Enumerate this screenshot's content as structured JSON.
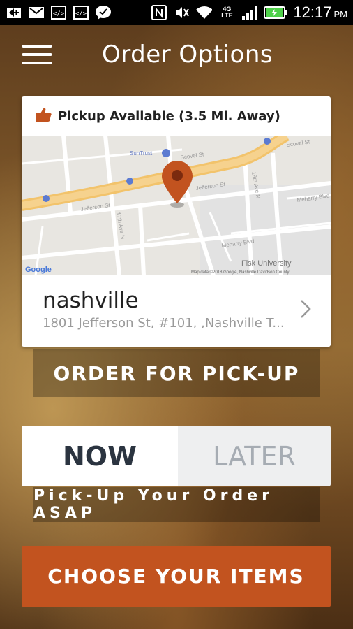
{
  "status_bar": {
    "time": "12:17",
    "ampm": "PM",
    "network": "4G LTE",
    "icons": [
      "add-icon",
      "gmail-icon",
      "code-icon",
      "code-icon",
      "chat-icon",
      "nfc-icon",
      "mute-icon",
      "wifi-icon",
      "signal-icon",
      "battery-icon"
    ]
  },
  "header": {
    "title": "Order Options",
    "menu_icon": "hamburger-menu-icon"
  },
  "location_card": {
    "pickup_text": "Pickup Available (3.5 Mi. Away)",
    "pickup_icon": "thumbs-up-icon",
    "map": {
      "labels": [
        "SunTrust",
        "Jefferson St",
        "Jefferson St",
        "17th Ave N",
        "18th Ave N",
        "Meharry Blvd",
        "Meharry Blvd",
        "Fisk University",
        "Scovel St",
        "Scovel St",
        "Google",
        "Map data ©2018 Google, Nashville Davidson County"
      ],
      "marker_icon": "map-pin-icon",
      "accent_color": "#c2531f"
    },
    "name": "nashville",
    "address": "1801 Jefferson St, #101, ,Nashville T..."
  },
  "order_type_button": "ORDER FOR PICK-UP",
  "timing_toggle": {
    "options": [
      "NOW",
      "LATER"
    ],
    "selected": "NOW"
  },
  "timing_hint": "Pick-Up Your Order ASAP",
  "primary_button": {
    "label": "CHOOSE YOUR ITEMS",
    "color": "#c2531f"
  }
}
